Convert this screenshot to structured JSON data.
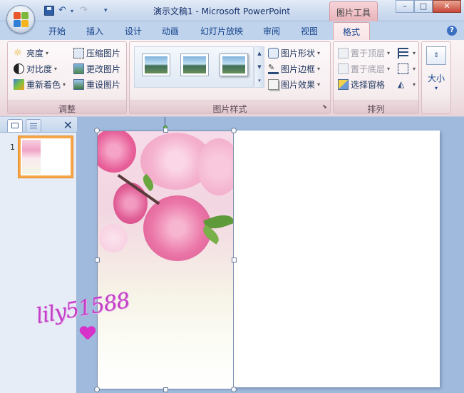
{
  "app": {
    "title": "演示文稿1 - Microsoft PowerPoint",
    "context_tab": "图片工具"
  },
  "window_buttons": {
    "minimize": "–",
    "maximize": "□",
    "close": "✕"
  },
  "tabs": [
    "开始",
    "插入",
    "设计",
    "动画",
    "幻灯片放映",
    "审阅",
    "视图",
    "格式"
  ],
  "active_tab": "格式",
  "ribbon": {
    "adjust": {
      "label": "调整",
      "brightness": "亮度",
      "contrast": "对比度",
      "recolor": "重新着色",
      "compress": "压缩图片",
      "change": "更改图片",
      "reset": "重设图片"
    },
    "styles": {
      "label": "图片样式",
      "shape": "图片形状",
      "border": "图片边框",
      "effect": "图片效果"
    },
    "arrange": {
      "label": "排列",
      "bring_front": "置于顶层",
      "send_back": "置于底层",
      "selection_pane": "选择窗格"
    },
    "size": {
      "label": "大小"
    }
  },
  "slides_panel": {
    "slide_number": "1",
    "close": "✕"
  },
  "watermark": "lily51588",
  "colors": {
    "accent_tab": "#f7e4e7",
    "selection_border": "#f7a648",
    "watermark": "#c43fc8"
  }
}
